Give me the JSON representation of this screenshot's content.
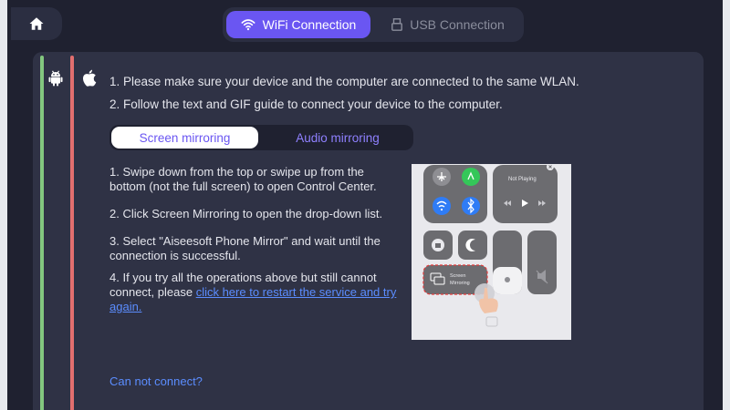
{
  "header": {
    "home_icon": "home-icon",
    "tabs": [
      {
        "label": "WiFi Connection",
        "icon": "wifi-icon",
        "active": true
      },
      {
        "label": "USB Connection",
        "icon": "usb-icon",
        "active": false
      }
    ]
  },
  "platforms": [
    {
      "icon": "android-icon"
    },
    {
      "icon": "apple-icon"
    }
  ],
  "instructions": [
    "1. Please make sure your device and the computer are connected to the same WLAN.",
    "2. Follow the text and GIF guide to connect your device to the computer."
  ],
  "mode_tabs": [
    {
      "label": "Screen mirroring",
      "active": true
    },
    {
      "label": "Audio mirroring",
      "active": false
    }
  ],
  "steps": {
    "s1": "1. Swipe down from the top or swipe up from the bottom (not the full screen) to open Control Center.",
    "s2": "2. Click Screen Mirroring to open the drop-down list.",
    "s3": "3. Select \"Aiseesoft Phone Mirror\" and wait until the connection is successful.",
    "s4_text": "4. If you try all the operations above but still cannot connect, please ",
    "s4_link": "click here to restart the service and try again."
  },
  "guide_image": {
    "now_playing": "Not Playing",
    "screen_mirroring_line1": "Screen",
    "screen_mirroring_line2": "Mirroring"
  },
  "footer": {
    "cannot_connect": "Can not connect?"
  },
  "colors": {
    "accent": "#6a56f2",
    "link": "#5b8dff",
    "android_stripe": "#83c77f",
    "ios_stripe": "#e26f6f"
  }
}
